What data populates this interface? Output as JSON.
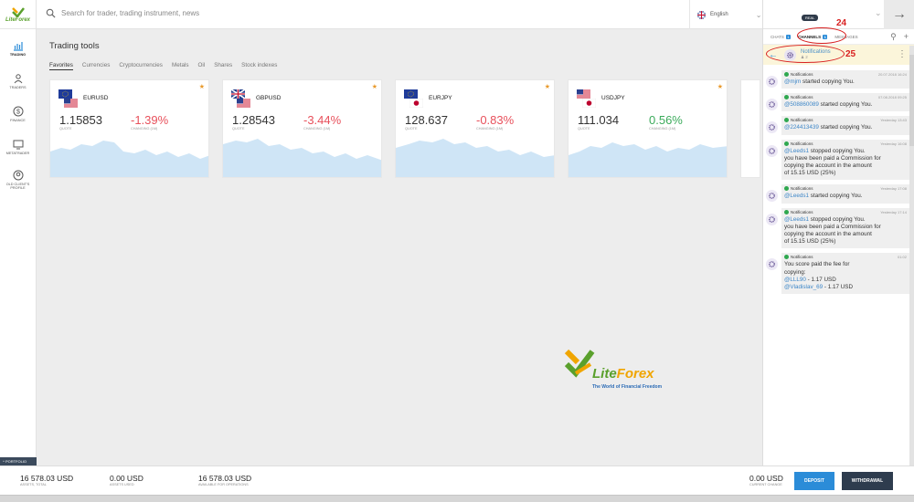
{
  "app": {
    "logo_text": "LiteForex"
  },
  "search": {
    "placeholder": "Search for trader, trading instrument, news"
  },
  "language": {
    "selected": "English"
  },
  "nav": [
    {
      "label": "Trading",
      "icon": "chart-bars-icon"
    },
    {
      "label": "Traders",
      "icon": "traders-icon"
    },
    {
      "label": "Finance",
      "icon": "dollar-icon"
    },
    {
      "label": "MetaTrader",
      "icon": "monitor-icon"
    },
    {
      "label": "Old client's profile",
      "icon": "user-circle-icon"
    }
  ],
  "portfolio_tab": "Portfolio",
  "account": {
    "badge": "Real"
  },
  "main": {
    "title": "Trading tools",
    "categories": [
      "Favorites",
      "Currencies",
      "Cryptocurrencies",
      "Metals",
      "Oil",
      "Shares",
      "Stock indexes"
    ],
    "active_category": "Favorites",
    "quote_label": "Quote",
    "change_label": "Changing (1M)",
    "cards": [
      {
        "symbol": "EURUSD",
        "quote": "1.15853",
        "change": "-1.39%",
        "change_color": "#e8505b"
      },
      {
        "symbol": "GBPUSD",
        "quote": "1.28543",
        "change": "-3.44%",
        "change_color": "#e8505b"
      },
      {
        "symbol": "EURJPY",
        "quote": "128.637",
        "change": "-0.83%",
        "change_color": "#e8505b"
      },
      {
        "symbol": "USDJPY",
        "quote": "111.034",
        "change": "0.56%",
        "change_color": "#3bab5b"
      }
    ]
  },
  "watermark": {
    "brand_a": "Lite",
    "brand_b": "Forex",
    "tagline": "The World of Financial Freedom"
  },
  "panel": {
    "tabs": [
      {
        "label": "Chats",
        "count": "1"
      },
      {
        "label": "Channels",
        "count": "1"
      },
      {
        "label": "Messages",
        "count": ""
      }
    ],
    "annotation_24": "24",
    "annotation_25": "25",
    "channel_title": "Notifications",
    "channel_members": "2",
    "messages": [
      {
        "sender": "Notifications",
        "time": "20.07.2018 16:24",
        "user": "@mjm",
        "text": " started copying You.",
        "extra": []
      },
      {
        "sender": "Notifications",
        "time": "07.08.2018 09:25",
        "user": "@508860089",
        "text": " started copying You.",
        "extra": []
      },
      {
        "sender": "Notifications",
        "time": "Yesterday 13:43",
        "user": "@224413439",
        "text": " started copying You.",
        "extra": []
      },
      {
        "sender": "Notifications",
        "time": "Yesterday 16:08",
        "user": "@Leeds1",
        "text": " stopped copying You.",
        "extra": [
          "you have been paid a Commission for",
          "copying the account in the amount",
          "of 15.15 USD (25%)"
        ]
      },
      {
        "sender": "Notifications",
        "time": "Yesterday 17:08",
        "user": "@Leeds1",
        "text": " started copying You.",
        "extra": []
      },
      {
        "sender": "Notifications",
        "time": "Yesterday 17:14",
        "user": "@Leeds1",
        "text": " stopped copying You.",
        "extra": [
          "you have been paid a Commission for",
          "copying the account in the amount",
          "of 15.15 USD (25%)"
        ]
      },
      {
        "sender": "Notifications",
        "time": "01:02",
        "user": "",
        "text": "",
        "fee": {
          "line1": "You score paid the fee for",
          "line2": "copying:",
          "u1": "@LLL90",
          "a1": " - 1.17 USD",
          "u2": "@Vladislav_69",
          "a2": " - 1.17 USD"
        },
        "extra": []
      }
    ]
  },
  "footer": {
    "assets_total": {
      "value": "16 578.03 USD",
      "label": "Assets, total"
    },
    "assets_used": {
      "value": "0.00 USD",
      "label": "Assets used"
    },
    "available": {
      "value": "16 578.03 USD",
      "label": "Available for operations"
    },
    "current_change": {
      "value": "0.00 USD",
      "label": "Current change"
    },
    "deposit": "Deposit",
    "withdrawal": "Withdrawal"
  }
}
